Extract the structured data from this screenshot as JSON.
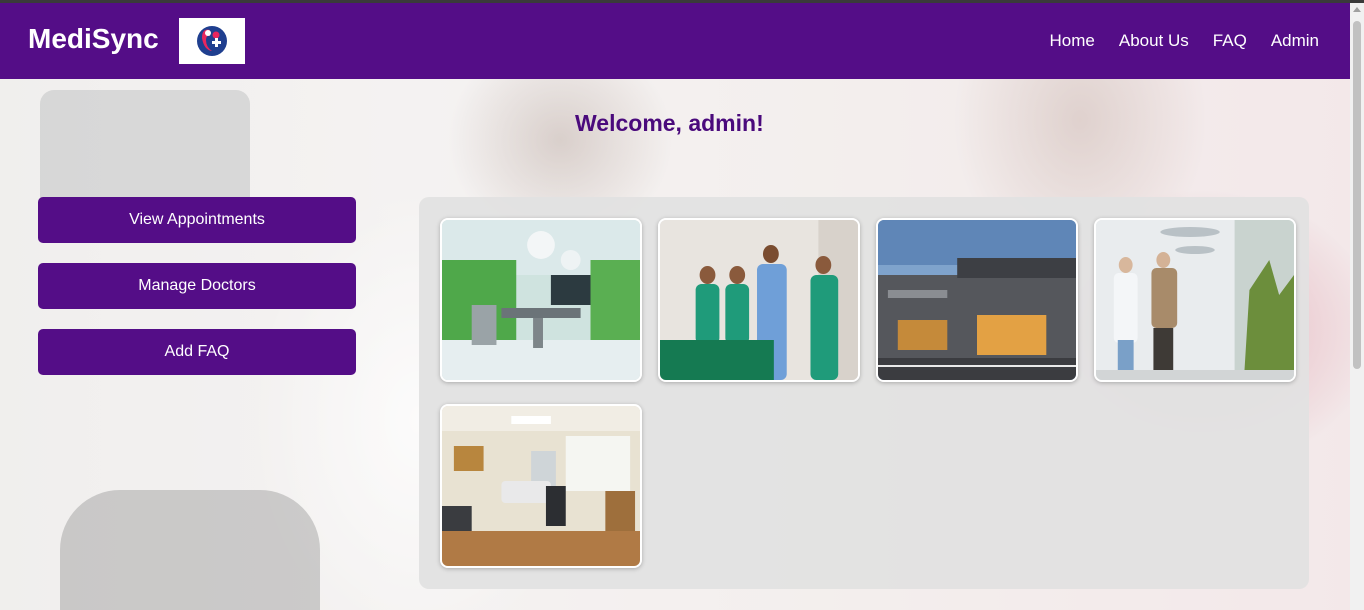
{
  "app": {
    "name": "MediSync"
  },
  "nav": {
    "items": [
      "Home",
      "About Us",
      "FAQ",
      "Admin"
    ]
  },
  "main": {
    "welcome": "Welcome, admin!"
  },
  "actions": {
    "view_appointments": "View Appointments",
    "manage_doctors": "Manage Doctors",
    "add_faq": "Add FAQ"
  },
  "gallery": {
    "images": [
      "operating-room-image",
      "medical-staff-image",
      "hospital-building-image",
      "hospital-lobby-image",
      "exam-room-image"
    ]
  },
  "colors": {
    "primary": "#540d87",
    "welcome_text": "#4a0a7c",
    "panel": "#e1e1e1"
  }
}
